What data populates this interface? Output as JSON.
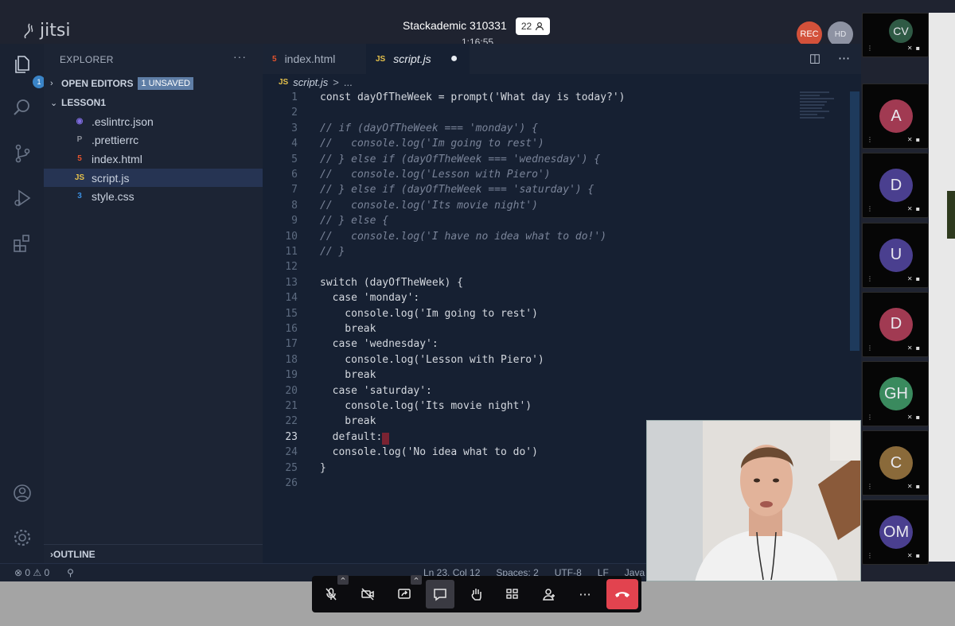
{
  "jitsi": {
    "logo_text": "jitsi",
    "meeting_title": "Stackademic 310331",
    "participant_count": "22",
    "timer": "1:16:55",
    "rec_label": "REC",
    "quality_label": "HD"
  },
  "vscode": {
    "activity": {
      "explorer_badge": "1"
    },
    "sidebar": {
      "title": "EXPLORER",
      "more": "···",
      "open_editors": "OPEN EDITORS",
      "unsaved_badge": "1 UNSAVED",
      "folder": "LESSON1",
      "files": [
        {
          "name": ".eslintrc.json",
          "icon": "eslint-icon",
          "color": "#7f6ce0"
        },
        {
          "name": ".prettierrc",
          "icon": "prettier-icon",
          "color": "#8a8f99"
        },
        {
          "name": "index.html",
          "icon": "html-icon",
          "color": "#e5532d"
        },
        {
          "name": "script.js",
          "icon": "js-icon",
          "color": "#e5c14b"
        },
        {
          "name": "style.css",
          "icon": "css-icon",
          "color": "#3b8fe0"
        }
      ],
      "outline": "OUTLINE"
    },
    "tabs": [
      {
        "label": "index.html",
        "icon": "html-icon"
      },
      {
        "label": "script.js",
        "icon": "js-icon",
        "dirty": "●"
      }
    ],
    "breadcrumb": {
      "file": "script.js",
      "sep": ">",
      "rest": "..."
    },
    "code_lines": [
      {
        "n": "1",
        "text": "const dayOfTheWeek = prompt('What day is today?')"
      },
      {
        "n": "2",
        "text": ""
      },
      {
        "n": "3",
        "text": "// if (dayOfTheWeek === 'monday') {"
      },
      {
        "n": "4",
        "text": "//   console.log('Im going to rest')"
      },
      {
        "n": "5",
        "text": "// } else if (dayOfTheWeek === 'wednesday') {"
      },
      {
        "n": "6",
        "text": "//   console.log('Lesson with Piero')"
      },
      {
        "n": "7",
        "text": "// } else if (dayOfTheWeek === 'saturday') {"
      },
      {
        "n": "8",
        "text": "//   console.log('Its movie night')"
      },
      {
        "n": "9",
        "text": "// } else {"
      },
      {
        "n": "10",
        "text": "//   console.log('I have no idea what to do!')"
      },
      {
        "n": "11",
        "text": "// }"
      },
      {
        "n": "12",
        "text": ""
      },
      {
        "n": "13",
        "text": "switch (dayOfTheWeek) {"
      },
      {
        "n": "14",
        "text": "  case 'monday':"
      },
      {
        "n": "15",
        "text": "    console.log('Im going to rest')"
      },
      {
        "n": "16",
        "text": "    break"
      },
      {
        "n": "17",
        "text": "  case 'wednesday':"
      },
      {
        "n": "18",
        "text": "    console.log('Lesson with Piero')"
      },
      {
        "n": "19",
        "text": "    break"
      },
      {
        "n": "20",
        "text": "  case 'saturday':"
      },
      {
        "n": "21",
        "text": "    console.log('Its movie night')"
      },
      {
        "n": "22",
        "text": "    break"
      },
      {
        "n": "23",
        "text": "  default:"
      },
      {
        "n": "24",
        "text": "  console.log('No idea what to do')"
      },
      {
        "n": "25",
        "text": "}"
      },
      {
        "n": "26",
        "text": ""
      }
    ],
    "status": {
      "errors": "⊗ 0",
      "warnings": "⚠ 0",
      "position": "Ln 23, Col 12",
      "spaces": "Spaces: 2",
      "encoding": "UTF-8",
      "eol": "LF",
      "language": "Java"
    }
  },
  "filmstrip": [
    {
      "initials": "CV",
      "color": "#2f5a45"
    },
    {
      "initials": "A",
      "color": "#a13a52"
    },
    {
      "initials": "D",
      "color": "#4a3f8f"
    },
    {
      "initials": "U",
      "color": "#4a3f8f"
    },
    {
      "initials": "D",
      "color": "#a13a52"
    },
    {
      "initials": "GH",
      "color": "#3a8a5e"
    },
    {
      "initials": "C",
      "color": "#8a6a3a"
    },
    {
      "initials": "OM",
      "color": "#4a3f8f"
    }
  ],
  "toolbar": {
    "buttons": [
      "microphone-muted-icon",
      "camera-off-icon",
      "screen-share-icon",
      "chat-icon",
      "raise-hand-icon",
      "tile-view-icon",
      "invite-icon",
      "more-icon",
      "hangup-icon"
    ],
    "more_label": "···"
  }
}
